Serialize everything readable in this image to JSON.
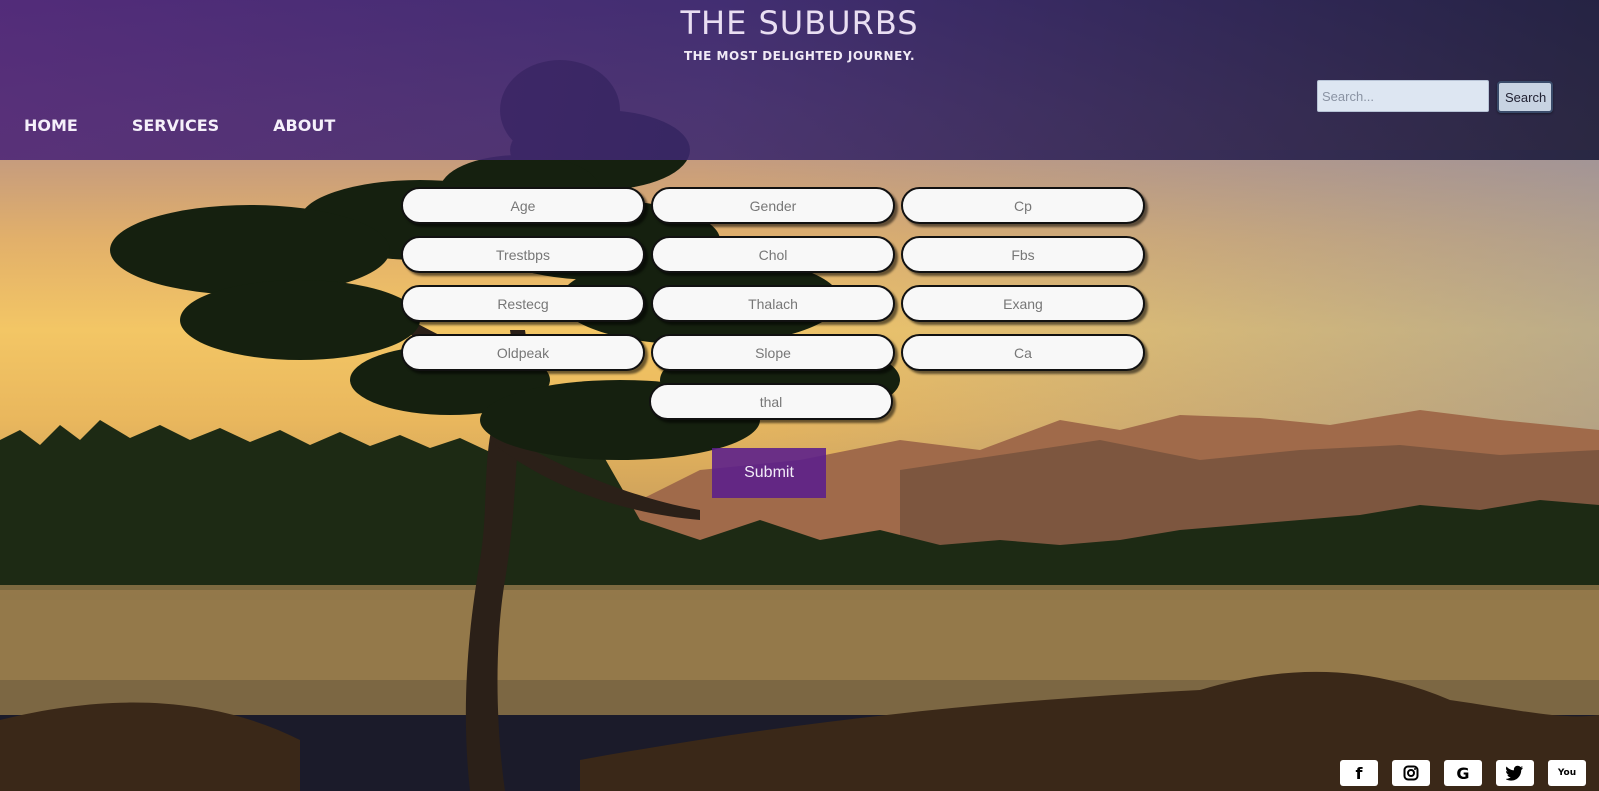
{
  "header": {
    "title": "THE SUBURBS",
    "tagline": "THE MOST DELIGHTED JOURNEY."
  },
  "nav": {
    "home": "HOME",
    "services": "SERVICES",
    "about": "ABOUT"
  },
  "search": {
    "placeholder": "Search...",
    "button_label": "Search"
  },
  "form": {
    "fields": [
      {
        "placeholder": "Age"
      },
      {
        "placeholder": "Gender"
      },
      {
        "placeholder": "Cp"
      },
      {
        "placeholder": "Trestbps"
      },
      {
        "placeholder": "Chol"
      },
      {
        "placeholder": "Fbs"
      },
      {
        "placeholder": "Restecg"
      },
      {
        "placeholder": "Thalach"
      },
      {
        "placeholder": "Exang"
      },
      {
        "placeholder": "Oldpeak"
      },
      {
        "placeholder": "Slope"
      },
      {
        "placeholder": "Ca"
      },
      {
        "placeholder": "thal"
      }
    ],
    "submit_label": "Submit"
  },
  "social": {
    "facebook": "f",
    "google": "G",
    "youtube": "You"
  },
  "colors": {
    "header": "#4b2a78",
    "submit": "#5a1e8c",
    "field_bg": "#f8f8f8"
  }
}
